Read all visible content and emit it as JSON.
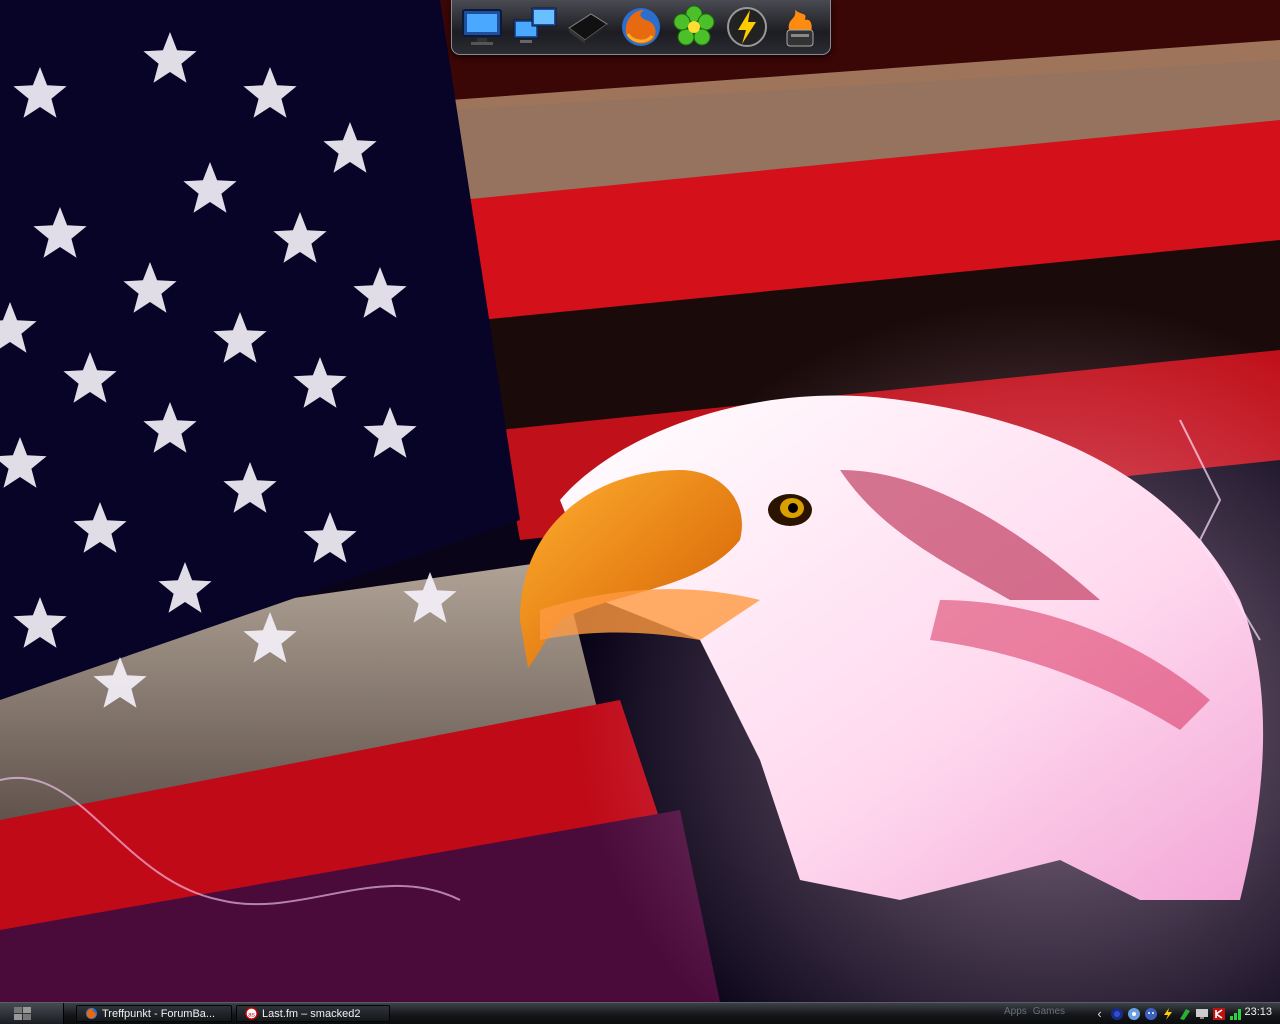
{
  "desktop": {
    "wallpaper": "american-flag-eagle"
  },
  "dock": {
    "items": [
      {
        "icon": "monitor-icon"
      },
      {
        "icon": "network-monitors-icon"
      },
      {
        "icon": "hard-drive-icon"
      },
      {
        "icon": "firefox-icon"
      },
      {
        "icon": "icq-flower-icon"
      },
      {
        "icon": "lightning-icon"
      },
      {
        "icon": "fire-cup-icon"
      }
    ]
  },
  "taskbar": {
    "tasks": [
      {
        "label": "Treffpunkt - ForumBa...",
        "icon": "firefox-icon"
      },
      {
        "label": "Last.fm – smacked2",
        "icon": "lastfm-icon"
      }
    ],
    "toolbars": [
      "Apps",
      "Games"
    ],
    "tray_chevron": "‹",
    "clock": "23:13"
  },
  "colors": {
    "flag_red": "#d4101a",
    "flag_blue": "#0a0630",
    "taskbar": "#15171b"
  }
}
